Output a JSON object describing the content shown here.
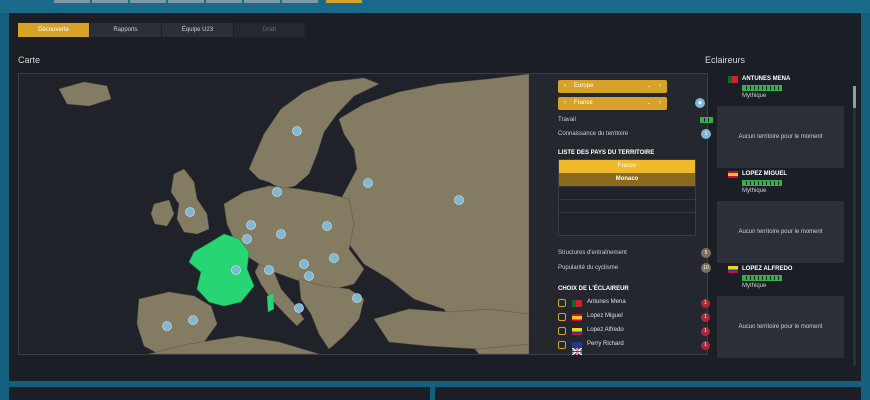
{
  "tabs": [
    {
      "label": "Découverte",
      "state": "active"
    },
    {
      "label": "Rapports",
      "state": "normal"
    },
    {
      "label": "Équipe U23",
      "state": "normal"
    },
    {
      "label": "Draft",
      "state": "disabled"
    }
  ],
  "map_section": {
    "title": "Carte"
  },
  "filters": {
    "region": {
      "value": "Europe",
      "prev": "‹",
      "next": "›",
      "dropdown": "⌄"
    },
    "country": {
      "value": "France",
      "prev": "‹",
      "next": "›",
      "dropdown": "⌄"
    }
  },
  "stats": {
    "work_label": "Travail",
    "knowledge_label": "Connaissance du territoire",
    "knowledge_value": "1",
    "training_label": "Structures d'entraînement",
    "training_value": "5",
    "popularity_label": "Popularité du cyclisme",
    "popularity_value": "10"
  },
  "country_list": {
    "title": "LISTE DES PAYS DU TERRITOIRE",
    "items": [
      "France",
      "Monaco"
    ]
  },
  "scout_choice": {
    "title": "CHOIX DE L'ÉCLAIREUR",
    "items": [
      {
        "name": "Antunes Mena",
        "badge": "1",
        "flag": "portugal-flag"
      },
      {
        "name": "Lopez Miguel",
        "badge": "1",
        "flag": "spain-flag"
      },
      {
        "name": "Lopez Alfredo",
        "badge": "1",
        "flag": "colombia-flag"
      },
      {
        "name": "Perry Richard",
        "badge": "1",
        "flag": "uk-flag"
      }
    ]
  },
  "scouts_section": {
    "title": "Eclaireurs",
    "scouts": [
      {
        "name": "ANTUNES MENA",
        "rank": "Mythique",
        "flag": "portugal-flag",
        "territory": "Aucun territoire pour le moment"
      },
      {
        "name": "LOPEZ MIGUEL",
        "rank": "Mythique",
        "flag": "spain-flag",
        "territory": "Aucun territoire pour le moment"
      },
      {
        "name": "LOPEZ ALFREDO",
        "rank": "Mythique",
        "flag": "colombia-flag",
        "territory": "Aucun territoire pour le moment"
      }
    ]
  },
  "colors": {
    "accent": "#d6a22a",
    "land": "#847b63",
    "selected_country": "#27d672",
    "background": "#1b1e25"
  }
}
